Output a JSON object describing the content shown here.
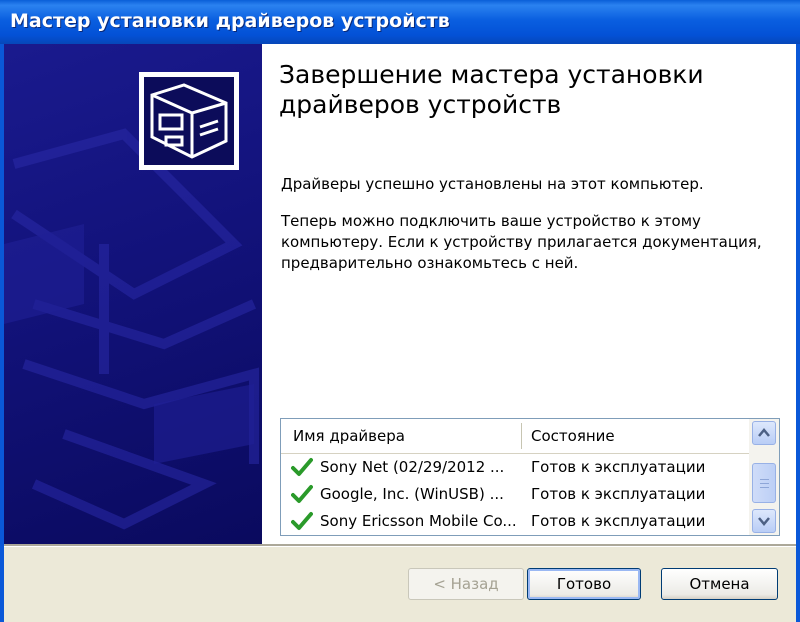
{
  "window": {
    "title": "Мастер установки драйверов устройств"
  },
  "content": {
    "heading": "Завершение мастера установки драйверов устройств",
    "paragraph1": "Драйверы успешно установлены на этот компьютер.",
    "paragraph2": "Теперь можно подключить ваше устройство к этому компьютеру. Если к устройству прилагается документация, предварительно ознакомьтесь с ней."
  },
  "driver_list": {
    "columns": [
      "Имя драйвера",
      "Состояние"
    ],
    "rows": [
      {
        "name": "Sony Net  (02/29/2012 ...",
        "status": "Готов к эксплуатации",
        "icon": "check-icon"
      },
      {
        "name": "Google, Inc. (WinUSB) ...",
        "status": "Готов к эксплуатации",
        "icon": "check-icon"
      },
      {
        "name": "Sony Ericsson Mobile Co...",
        "status": "Готов к эксплуатации",
        "icon": "check-icon"
      }
    ]
  },
  "buttons": {
    "back": "< Назад",
    "done": "Готово",
    "cancel": "Отмена"
  },
  "colors": {
    "titlebar": "#0a5fd8",
    "banner": "#12127a",
    "check": "#2a9a2a"
  }
}
